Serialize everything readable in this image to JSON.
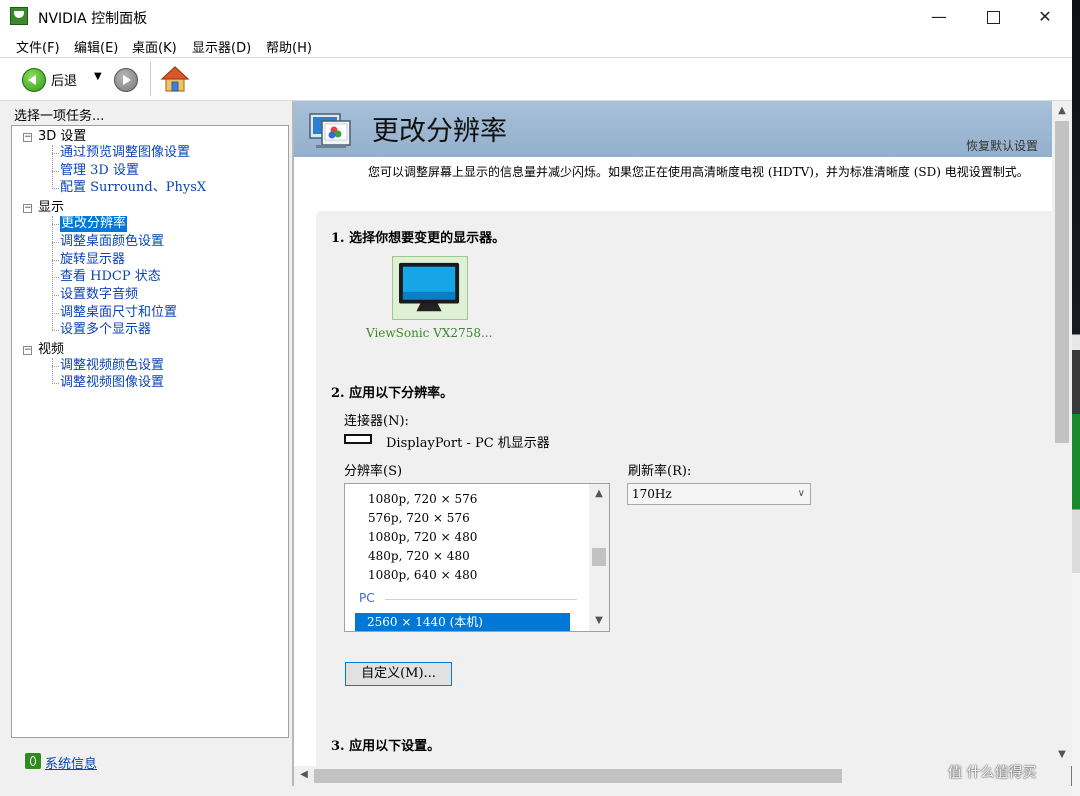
{
  "window": {
    "title": "NVIDIA 控制面板"
  },
  "menu": [
    "文件(F)",
    "编辑(E)",
    "桌面(K)",
    "显示器(D)",
    "帮助(H)"
  ],
  "toolbar": {
    "back_label": "后退"
  },
  "sidebar": {
    "header": "选择一项任务...",
    "groups": [
      {
        "label": "3D 设置",
        "items": [
          "通过预览调整图像设置",
          "管理 3D 设置",
          "配置 Surround、PhysX"
        ]
      },
      {
        "label": "显示",
        "items": [
          "更改分辨率",
          "调整桌面颜色设置",
          "旋转显示器",
          "查看 HDCP 状态",
          "设置数字音频",
          "调整桌面尺寸和位置",
          "设置多个显示器"
        ]
      },
      {
        "label": "视频",
        "items": [
          "调整视频颜色设置",
          "调整视频图像设置"
        ]
      }
    ],
    "selected": "更改分辨率",
    "system_info": "系统信息"
  },
  "page": {
    "title": "更改分辨率",
    "restore_defaults": "恢复默认设置",
    "description": "您可以调整屏幕上显示的信息量并减少闪烁。如果您正在使用高清晰度电视 (HDTV)，并为标准清晰度 (SD) 电视设置制式。",
    "step1": "1. 选择你想要变更的显示器。",
    "monitor_name": "ViewSonic VX2758...",
    "step2": "2. 应用以下分辨率。",
    "connector_label": "连接器(N):",
    "connector_value": "DisplayPort - PC 机显示器",
    "resolution_label": "分辨率(S)",
    "refresh_label": "刷新率(R):",
    "refresh_value": "170Hz",
    "resolutions": [
      "1080p, 720 × 576",
      "576p, 720 × 576",
      "1080p, 720 × 480",
      "480p, 720 × 480",
      "1080p, 640 × 480"
    ],
    "group_pc": "PC",
    "selected_resolution": "2560 × 1440 (本机)",
    "custom_button": "自定义(M)...",
    "step3": "3. 应用以下设置。"
  },
  "watermark": "值 什么值得买",
  "colors": {
    "accent": "#0078d7",
    "banner": "#9fb8d2",
    "nvidia_green": "#3a8a2a"
  }
}
